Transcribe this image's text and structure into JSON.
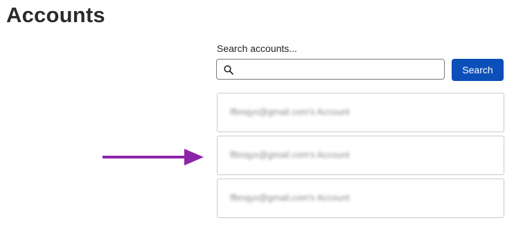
{
  "page": {
    "title": "Accounts"
  },
  "search": {
    "label": "Search accounts...",
    "value": "",
    "placeholder": "",
    "button_label": "Search",
    "icon": "search-icon"
  },
  "accounts": [
    {
      "label": "lfbnqyx@gmail.com's Account"
    },
    {
      "label": "lfbnqyx@gmail.com's Account"
    },
    {
      "label": "lfbnqyx@gmail.com's Account"
    }
  ],
  "annotation": {
    "icon": "arrow-right-icon",
    "color": "#8e24aa"
  },
  "colors": {
    "primary_button": "#0b4fb8",
    "border": "#c9c9c9"
  }
}
